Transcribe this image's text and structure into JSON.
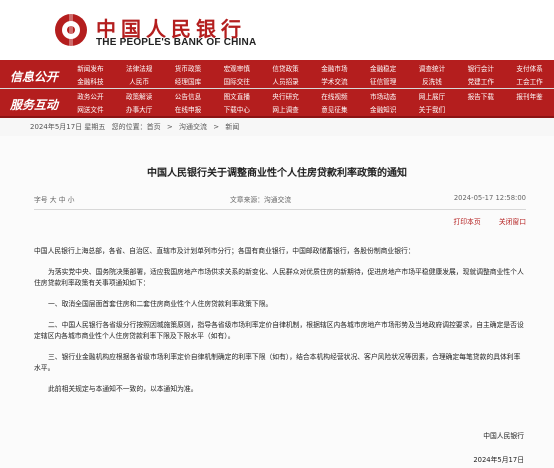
{
  "header": {
    "name_cn": "中国人民银行",
    "name_en": "THE PEOPLE'S BANK OF CHINA",
    "brand_color": "#b41e1e"
  },
  "nav": {
    "section_labels": [
      "信息公开",
      "服务互动"
    ],
    "rows": [
      [
        "新闻发布",
        "法律法规",
        "货币政策",
        "宏观审慎",
        "信贷政策",
        "金融市场",
        "金融稳定",
        "调查统计",
        "银行会计",
        "支付体系"
      ],
      [
        "金融科技",
        "人民币",
        "经理国库",
        "国际交往",
        "人员招录",
        "学术交流",
        "征信管理",
        "反洗钱",
        "党建工作",
        "工会工作"
      ],
      [
        "政务公开",
        "政策解读",
        "公告信息",
        "图文直播",
        "央行研究",
        "在线视频",
        "市场动态",
        "网上展厅",
        "报告下载",
        "报刊年鉴"
      ],
      [
        "网送文件",
        "办事大厅",
        "在线申报",
        "下载中心",
        "网上调查",
        "意见征集",
        "金融知识",
        "关于我们",
        "",
        ""
      ]
    ]
  },
  "breadcrumb": {
    "date": "2024年5月17日 星期五",
    "items": [
      "您的位置：首页",
      "沟通交流",
      "新闻"
    ]
  },
  "article": {
    "title": "中国人民银行关于调整商业性个人住房贷款利率政策的通知",
    "font_size_label": "字号 大 中 小",
    "source": "文章来源：沟通交流",
    "date": "2024-05-17 12:58:00",
    "print_label": "打印本页",
    "close_label": "关闭窗口",
    "addressee": "中国人民银行上海总部，各省、自治区、直辖市及计划单列市分行；各国有商业银行，中国邮政储蓄银行，各股份制商业银行：",
    "paragraphs": [
      "为落实党中央、国务院决策部署，适应我国房地产市场供求关系的新变化、人民群众对优质住房的新期待，促进房地产市场平稳健康发展，现就调整商业性个人住房贷款利率政策有关事项通知如下：",
      "一、取消全国层面首套住房和二套住房商业性个人住房贷款利率政策下限。",
      "二、中国人民银行各省级分行按照因城施策原则，指导各省级市场利率定价自律机制，根据辖区内各城市房地产市场形势及当地政府调控要求，自主确定是否设定辖区内各城市商业性个人住房贷款利率下限及下限水平（如有）。",
      "三、银行业金融机构应根据各省级市场利率定价自律机制确定的利率下限（如有），结合本机构经营状况、客户风险状况等因素，合理确定每笔贷款的具体利率水平。",
      "此前相关规定与本通知不一致的，以本通知为准。"
    ],
    "signature": "中国人民银行",
    "sign_date": "2024年5月17日"
  }
}
